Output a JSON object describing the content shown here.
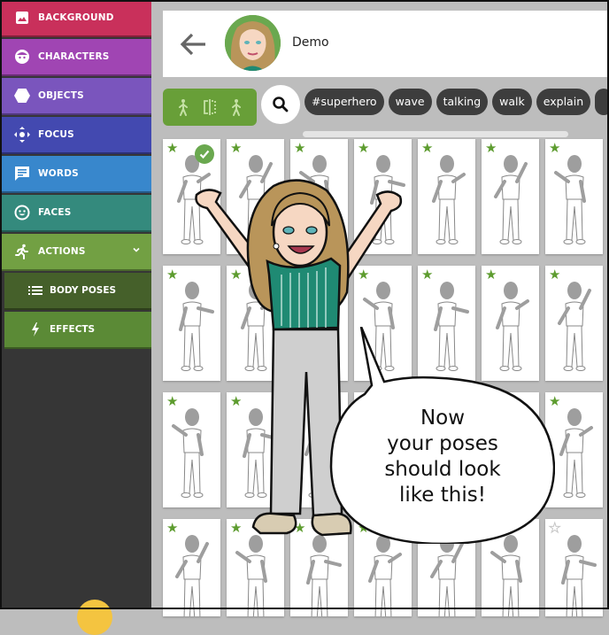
{
  "sidebar": {
    "items": [
      {
        "label": "BACKGROUND",
        "icon": "image-icon",
        "color": "#c9305b"
      },
      {
        "label": "CHARACTERS",
        "icon": "character-face-icon",
        "color": "#a045b3"
      },
      {
        "label": "OBJECTS",
        "icon": "hexagon-icon",
        "color": "#7a55bd"
      },
      {
        "label": "FOCUS",
        "icon": "move-arrows-icon",
        "color": "#4349b0"
      },
      {
        "label": "WORDS",
        "icon": "speech-bubble-icon",
        "color": "#3887cc"
      },
      {
        "label": "FACES",
        "icon": "smiley-icon",
        "color": "#348a7d"
      },
      {
        "label": "ACTIONS",
        "icon": "running-person-icon",
        "color": "#72a043",
        "expanded": true
      }
    ],
    "sub_items": [
      {
        "label": "BODY POSES",
        "icon": "list-icon",
        "color": "#45602a",
        "selected": true
      },
      {
        "label": "EFFECTS",
        "icon": "lightning-icon",
        "color": "#5b8a36"
      }
    ]
  },
  "header": {
    "title": "Demo",
    "back_icon": "arrow-left-icon"
  },
  "toolbar": {
    "buttons": [
      "person-walk-left-icon",
      "flip-horizontal-icon",
      "person-walk-right-icon"
    ],
    "search_icon": "search-icon"
  },
  "tags": [
    "#superhero",
    "wave",
    "talking",
    "walk",
    "explain"
  ],
  "poses": {
    "rows": [
      [
        {
          "fav": true,
          "selected": true
        },
        {
          "fav": true
        },
        {
          "fav": true
        },
        {
          "fav": true
        },
        {
          "fav": true
        },
        {
          "fav": true
        },
        {
          "fav": true
        }
      ],
      [
        {
          "fav": true
        },
        {
          "fav": true
        },
        {
          "fav": true
        },
        {
          "fav": true
        },
        {
          "fav": true
        },
        {
          "fav": true
        },
        {
          "fav": true
        }
      ],
      [
        {
          "fav": true
        },
        {
          "fav": true
        },
        {
          "fav": true
        },
        {
          "fav": true
        },
        {
          "fav": true
        },
        {
          "fav": true
        },
        {
          "fav": true
        }
      ],
      [
        {
          "fav": true
        },
        {
          "fav": true
        },
        {
          "fav": true
        },
        {
          "fav": true
        },
        {
          "fav": true
        },
        {
          "fav": true
        },
        {
          "fav": false
        }
      ]
    ]
  },
  "bubble": {
    "lines": [
      "Now",
      "your poses",
      "should look",
      "like this!"
    ]
  }
}
